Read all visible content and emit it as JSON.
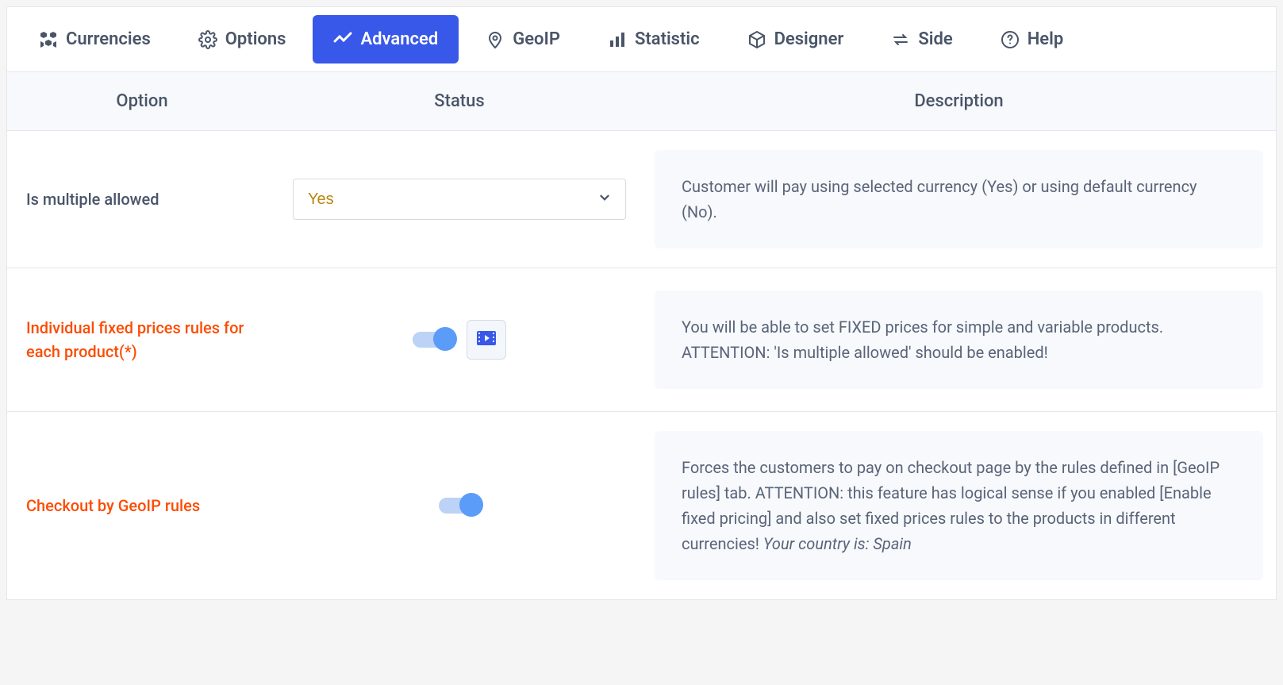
{
  "tabs": [
    {
      "label": "Currencies"
    },
    {
      "label": "Options"
    },
    {
      "label": "Advanced"
    },
    {
      "label": "GeoIP"
    },
    {
      "label": "Statistic"
    },
    {
      "label": "Designer"
    },
    {
      "label": "Side"
    },
    {
      "label": "Help"
    }
  ],
  "columns": {
    "option": "Option",
    "status": "Status",
    "description": "Description"
  },
  "rows": [
    {
      "option": "Is multiple allowed",
      "highlight": false,
      "control": "select",
      "value": "Yes",
      "description": "Customer will pay using selected currency (Yes) or using default currency (No)."
    },
    {
      "option": "Individual fixed prices rules for each product(*)",
      "highlight": true,
      "control": "toggle_video",
      "description": "You will be able to set FIXED prices for simple and variable products. ATTENTION: 'Is multiple allowed' should be enabled!"
    },
    {
      "option": "Checkout by GeoIP rules",
      "highlight": true,
      "control": "toggle",
      "description_main": "Forces the customers to pay on checkout page by the rules defined in [GeoIP rules] tab. ATTENTION: this feature has logical sense if you enabled [Enable fixed pricing] and also set fixed prices rules to the products in different currencies! ",
      "description_em": "Your country is: Spain"
    }
  ]
}
